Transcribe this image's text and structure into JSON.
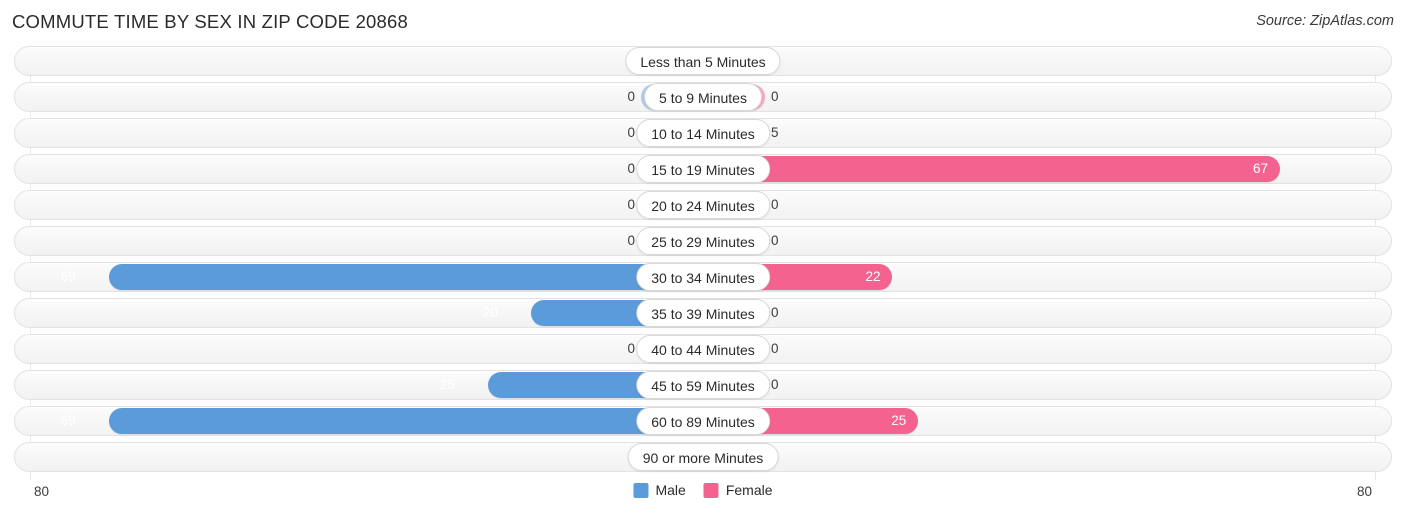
{
  "header": {
    "title": "COMMUTE TIME BY SEX IN ZIP CODE 20868",
    "source": "Source: ZipAtlas.com"
  },
  "legend": {
    "male_label": "Male",
    "female_label": "Female"
  },
  "axis": {
    "left_label": "80",
    "right_label": "80"
  },
  "colors": {
    "male_strong": "#5B9BD9",
    "male_light": "#AECBEB",
    "female_strong": "#F4628F",
    "female_light": "#F9A8C2"
  },
  "chart_data": {
    "type": "bar",
    "title": "COMMUTE TIME BY SEX IN ZIP CODE 20868",
    "subtitle": "Source: ZipAtlas.com",
    "orientation": "horizontal-diverging",
    "xlabel": "",
    "ylabel": "",
    "axis_max": 80,
    "xlim": [
      -80,
      80
    ],
    "grid": false,
    "legend_position": "bottom-center",
    "categories": [
      "Less than 5 Minutes",
      "5 to 9 Minutes",
      "10 to 14 Minutes",
      "15 to 19 Minutes",
      "20 to 24 Minutes",
      "25 to 29 Minutes",
      "30 to 34 Minutes",
      "35 to 39 Minutes",
      "40 to 44 Minutes",
      "45 to 59 Minutes",
      "60 to 89 Minutes",
      "90 or more Minutes"
    ],
    "series": [
      {
        "name": "Male",
        "direction": "left",
        "color": "#5B9BD9",
        "values": [
          0,
          0,
          0,
          0,
          0,
          0,
          69,
          20,
          0,
          25,
          69,
          0
        ]
      },
      {
        "name": "Female",
        "direction": "right",
        "color": "#F4628F",
        "values": [
          0,
          0,
          5,
          67,
          0,
          0,
          22,
          0,
          0,
          0,
          25,
          0
        ]
      }
    ]
  }
}
